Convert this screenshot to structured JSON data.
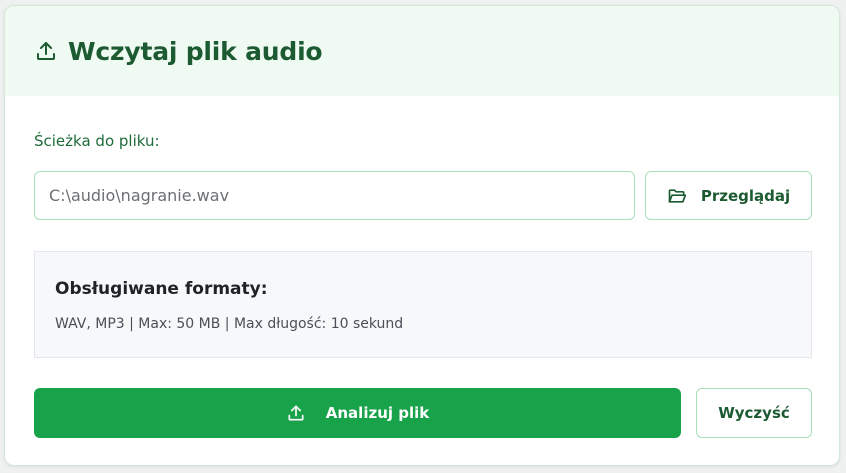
{
  "header": {
    "title": "Wczytaj plik audio",
    "icon": "upload-icon"
  },
  "path": {
    "label": "Ścieżka do pliku:",
    "value": "C:\\audio\\nagranie.wav",
    "placeholder": ""
  },
  "browse": {
    "label": "Przeglądaj",
    "icon": "folder-open-icon"
  },
  "formats": {
    "title": "Obsługiwane formaty:",
    "description": "WAV, MP3 | Max: 50 MB | Max długość: 10 sekund"
  },
  "actions": {
    "analyze_label": "Analizuj plik",
    "analyze_icon": "upload-icon",
    "clear_label": "Wyczyść"
  },
  "colors": {
    "primary": "#18a24a",
    "header_bg": "#effbf2",
    "title_text": "#1c5a31",
    "border": "#a8e0b8"
  }
}
